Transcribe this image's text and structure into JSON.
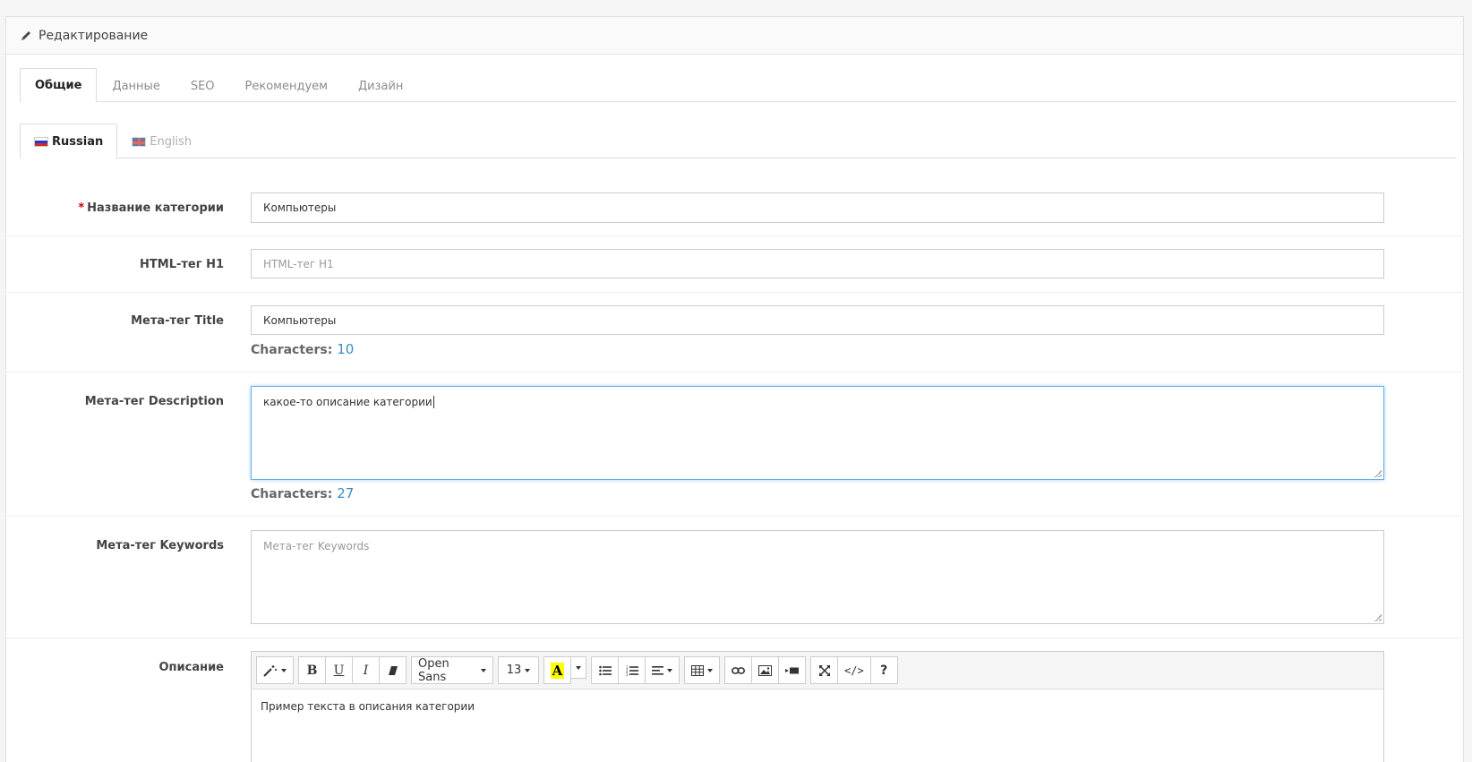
{
  "panel": {
    "title": "Редактирование",
    "icon": "pencil-icon"
  },
  "tabs": [
    {
      "label": "Общие",
      "active": true
    },
    {
      "label": "Данные"
    },
    {
      "label": "SEO"
    },
    {
      "label": "Рекомендуем"
    },
    {
      "label": "Дизайн"
    }
  ],
  "languages": [
    {
      "label": "Russian",
      "active": true
    },
    {
      "label": "English"
    }
  ],
  "form": {
    "name": {
      "required_mark": "*",
      "label": "Название категории",
      "value": "Компьютеры"
    },
    "h1": {
      "label": "HTML-тег H1",
      "placeholder": "HTML-тег H1"
    },
    "meta_title": {
      "label": "Мета-тег Title",
      "value": "Компьютеры",
      "chars_label": "Characters:",
      "chars": "10"
    },
    "meta_description": {
      "label": "Мета-тег Description",
      "value": "какое-то описание категории",
      "chars_label": "Characters:",
      "chars": "27"
    },
    "meta_keywords": {
      "label": "Мета-тег Keywords",
      "placeholder": "Мета-тег Keywords"
    },
    "description": {
      "label": "Описание",
      "content": "Пример текста в описания категории"
    }
  },
  "editor": {
    "font_name": "Open Sans",
    "font_size": "13",
    "highlight_color": "#ffff00",
    "color_letter": "A"
  },
  "colors": {
    "required": "#cc0000",
    "counter": "#3a8dc4",
    "focus": "#66afe9"
  }
}
